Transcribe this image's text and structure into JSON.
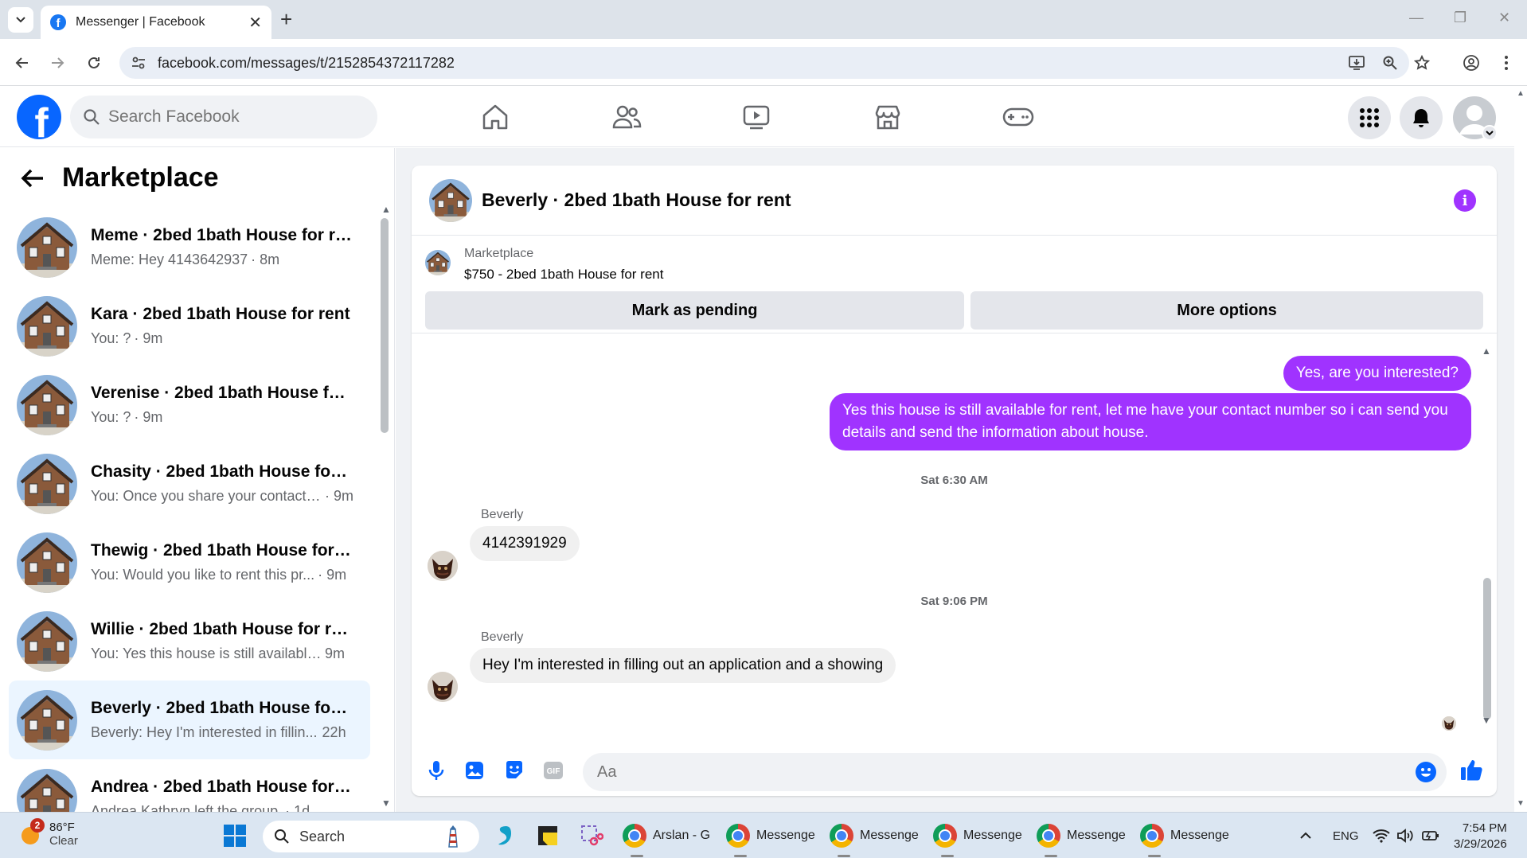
{
  "browser": {
    "tab_title": "Messenger | Facebook",
    "url": "facebook.com/messages/t/2152854372117282"
  },
  "fb": {
    "search_placeholder": "Search Facebook"
  },
  "sidebar": {
    "title": "Marketplace",
    "conversations": [
      {
        "name": "Meme · 2bed 1bath House for rent",
        "preview": "Meme: Hey 4143642937",
        "time": "· 8m"
      },
      {
        "name": "Kara · 2bed 1bath House for rent",
        "preview": "You: ?",
        "time": "· 9m"
      },
      {
        "name": "Verenise · 2bed 1bath House for ...",
        "preview": "You: ?",
        "time": "· 9m"
      },
      {
        "name": "Chasity · 2bed 1bath House for r...",
        "preview": "You: Once you share your contact ...",
        "time": "· 9m"
      },
      {
        "name": "Thewig · 2bed 1bath House for r...",
        "preview": "You: Would you like to rent this pr...",
        "time": "· 9m"
      },
      {
        "name": "Willie · 2bed 1bath House for rent",
        "preview": "You: Yes this house is still available ...",
        "time": "9m"
      },
      {
        "name": "Beverly · 2bed 1bath House for r...",
        "preview": "Beverly: Hey I'm interested in fillin...",
        "time": "22h"
      },
      {
        "name": "Andrea · 2bed 1bath House for r...",
        "preview": "Andrea Kathryn left the group.",
        "time": "· 1d"
      }
    ]
  },
  "chat": {
    "header_name": "Beverly · 2bed 1bath House for rent",
    "listing_source": "Marketplace",
    "listing_title": "$750 - 2bed 1bath House for rent",
    "mark_pending_label": "Mark as pending",
    "more_options_label": "More options",
    "messages": {
      "out1": "Yes, are you interested?",
      "out2": "Yes this house is still available for rent, let me have your contact number so i can send you details and send the information about house.",
      "ts1": "Sat 6:30 AM",
      "sender1": "Beverly",
      "in1": "4142391929",
      "ts2": "Sat 9:06 PM",
      "sender2": "Beverly",
      "in2": "Hey I'm interested in filling out an application and a showing"
    },
    "composer_placeholder": "Aa",
    "accent_color": "#a033ff"
  },
  "taskbar": {
    "weather_temp": "86°F",
    "weather_cond": "Clear",
    "weather_badge": "2",
    "search_label": "Search",
    "apps": [
      {
        "label": "Arslan - G"
      },
      {
        "label": "Messenge"
      },
      {
        "label": "Messenge"
      },
      {
        "label": "Messenge"
      },
      {
        "label": "Messenge"
      },
      {
        "label": "Messenge"
      }
    ],
    "lang": "ENG",
    "time": "7:54 PM",
    "date": "3/29/2026"
  }
}
